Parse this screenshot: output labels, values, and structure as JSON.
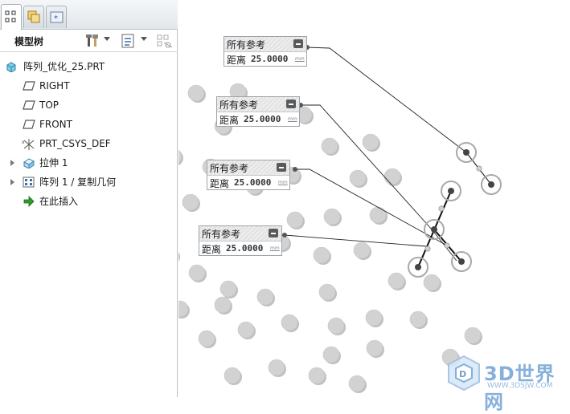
{
  "tabs": [
    {
      "name": "model-tree",
      "icon": "model-tree-icon"
    },
    {
      "name": "layers",
      "icon": "layers-icon"
    },
    {
      "name": "favorites",
      "icon": "star-folder-icon"
    }
  ],
  "tree": {
    "title": "模型树",
    "items": [
      {
        "label": "阵列_优化_25.PRT",
        "icon": "part-cube-icon"
      },
      {
        "label": "RIGHT",
        "icon": "datum-plane-icon"
      },
      {
        "label": "TOP",
        "icon": "datum-plane-icon"
      },
      {
        "label": "FRONT",
        "icon": "datum-plane-icon"
      },
      {
        "label": "PRT_CSYS_DEF",
        "icon": "csys-icon"
      },
      {
        "label": "拉伸 1",
        "icon": "extrude-icon"
      },
      {
        "label": "阵列 1 / 复制几何",
        "icon": "pattern-icon"
      },
      {
        "label": "在此插入",
        "icon": "insert-arrow-icon"
      }
    ]
  },
  "callouts": [
    {
      "title": "所有参考",
      "label": "距离",
      "value": "25.0000",
      "unit": "mm"
    },
    {
      "title": "所有参考",
      "label": "距离",
      "value": "25.0000",
      "unit": "mm"
    },
    {
      "title": "所有参考",
      "label": "距离",
      "value": "25.0000",
      "unit": "mm"
    },
    {
      "title": "所有参考",
      "label": "距离",
      "value": "25.0000",
      "unit": "mm"
    }
  ],
  "watermark": {
    "text": "3D世界网",
    "url": "WWW.3DSJW.COM"
  },
  "colors": {
    "hole_fill": "#d2d2d2",
    "hole_shadow": "#8c8c8c",
    "accent_green": "#2f9a2f"
  }
}
